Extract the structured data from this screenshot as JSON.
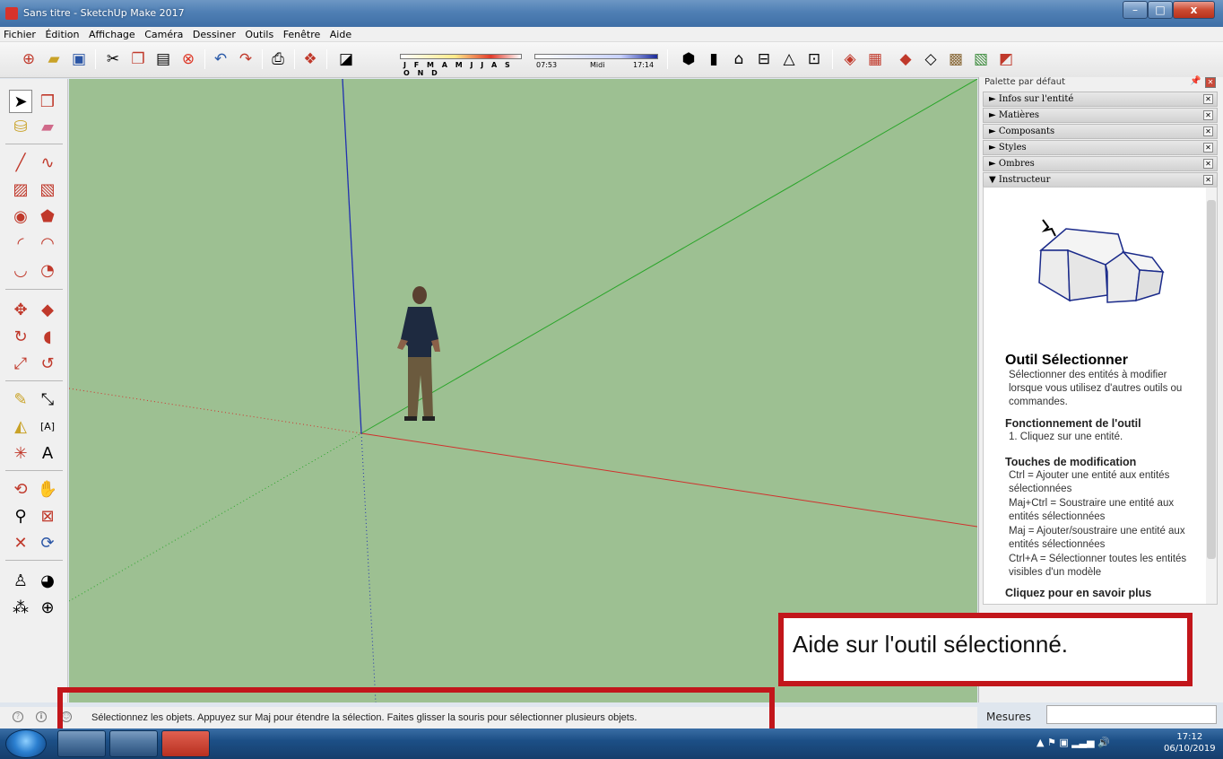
{
  "window": {
    "title": "Sans titre - SketchUp Make 2017",
    "min_glyph": "–",
    "max_glyph": "□",
    "close_glyph": "x"
  },
  "menu": [
    "Fichier",
    "Édition",
    "Affichage",
    "Caméra",
    "Dessiner",
    "Outils",
    "Fenêtre",
    "Aide"
  ],
  "toolbar": {
    "months": "J F M A M J J A S O N D",
    "time_start": "07:53",
    "time_mid": "Midi",
    "time_end": "17:14"
  },
  "right_palette": {
    "title": "Palette par défaut",
    "trays": [
      {
        "label": "► Infos sur l'entité",
        "expanded": false
      },
      {
        "label": "► Matières",
        "expanded": false
      },
      {
        "label": "► Composants",
        "expanded": false
      },
      {
        "label": "► Styles",
        "expanded": false
      },
      {
        "label": "► Ombres",
        "expanded": false
      },
      {
        "label": "▼ Instructeur",
        "expanded": true
      }
    ],
    "instructor": {
      "tool_name": "Outil Sélectionner",
      "description": "Sélectionner des entités à modifier lorsque vous utilisez d'autres outils ou commandes.",
      "operation_heading": "Fonctionnement de l'outil",
      "operation_step": "1. Cliquez sur une entité.",
      "modifiers_heading": "Touches de modification",
      "modifiers": [
        "Ctrl = Ajouter une entité aux entités sélectionnées",
        "Maj+Ctrl = Soustraire une entité aux entités sélectionnées",
        "Maj = Ajouter/soustraire une entité aux entités sélectionnées",
        "Ctrl+A = Sélectionner toutes les entités visibles d'un modèle"
      ],
      "learn_more": "Cliquez pour en savoir plus"
    },
    "measures_label": "Mesures",
    "measures_value": ""
  },
  "status": {
    "message": "Sélectionnez les objets. Appuyez sur Maj pour étendre la sélection. Faites glisser la souris pour sélectionner plusieurs objets."
  },
  "callout": {
    "help_text": "Aide sur l'outil sélectionné."
  },
  "taskbar": {
    "time": "17:12",
    "date": "06/10/2019"
  },
  "colors": {
    "viewport_bg": "#9dc092",
    "callout_border": "#c2161b",
    "axis_red": "#d0312d",
    "axis_green": "#2aa52a",
    "axis_blue": "#2030b0"
  },
  "icons": {
    "left_tools": [
      "select-arrow-icon",
      "make-component-icon",
      "paint-bucket-icon",
      "eraser-icon",
      "pencil-line-icon",
      "freehand-icon",
      "rectangle-icon",
      "rotated-rectangle-icon",
      "circle-icon",
      "polygon-icon",
      "arc-icon",
      "two-point-arc-icon",
      "three-point-arc-icon",
      "pie-icon",
      "move-icon",
      "push-pull-icon",
      "rotate-icon",
      "follow-me-icon",
      "scale-icon",
      "offset-icon",
      "tape-measure-icon",
      "dimension-icon",
      "protractor-icon",
      "text-icon",
      "axes-icon",
      "3d-text-icon",
      "orbit-icon",
      "pan-icon",
      "zoom-icon",
      "zoom-window-icon",
      "zoom-extents-icon",
      "previous-view-icon",
      "position-camera-icon",
      "look-around-icon",
      "walk-icon",
      "section-plane-icon"
    ]
  }
}
